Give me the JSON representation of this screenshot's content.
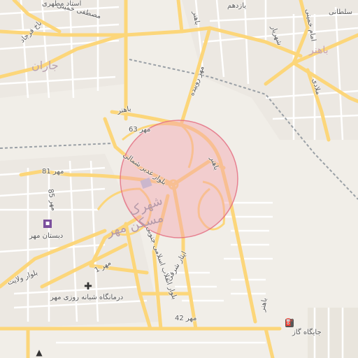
{
  "map": {
    "labels": {
      "street_bahonar_ne": "باهنر",
      "street_bahonar_mid": "باهنر",
      "street_bahonar_w": "باهنر",
      "street_bahonar_s": "باهنر",
      "street_bahonar_n": "باهنر",
      "street_yazdhom": "یازدهم",
      "street_shahriyar": "شهریار",
      "street_soltani": "سلطانی",
      "street_imam": "امام خمینی",
      "street_motahari": "استاد مطهری",
      "street_mostafa": "مصطفی خمینی",
      "street_nakhl": "ناخ فرجاد",
      "street_mehr_rooyideh": "مهر روییده",
      "street_mehr63": "مهر 63",
      "street_ghadir": "بلوار غدیر شمالی",
      "street_mehr81": "مهر 81",
      "street_mehr85": "مهر 85",
      "street_velayat": "بلوار ولایت",
      "street_mehr1": "مهر 1",
      "street_enghelab": "بلوار انقلاب اسلامی جنوبی",
      "street_isar": "ایثار شرقی",
      "street_mehr42": "مهر 42",
      "street_molla": "ملادی",
      "street_bist": "2 بیست",
      "district_jaran": "جاران",
      "district_maskan_1": "شهرک",
      "district_maskan_2": "مسکن مهر",
      "poi_school": "دبستان مهر",
      "poi_clinic": "درمانگاه شبانه روزی مهر",
      "poi_gas": "جایگاه گاز"
    },
    "icons": {
      "school": "school-icon",
      "clinic": "plus-icon",
      "gas": "fuel-icon",
      "cap": "graduation-cap-icon"
    },
    "colors": {
      "background": "#f1eee8",
      "major_road": "#fcd67a",
      "minor_road": "#ffffff",
      "circle_fill": "#f3a5b0",
      "circle_stroke": "#e46a7e",
      "park": "#cde8bb",
      "water": "#a9d3e6",
      "rail": "#999999"
    }
  }
}
